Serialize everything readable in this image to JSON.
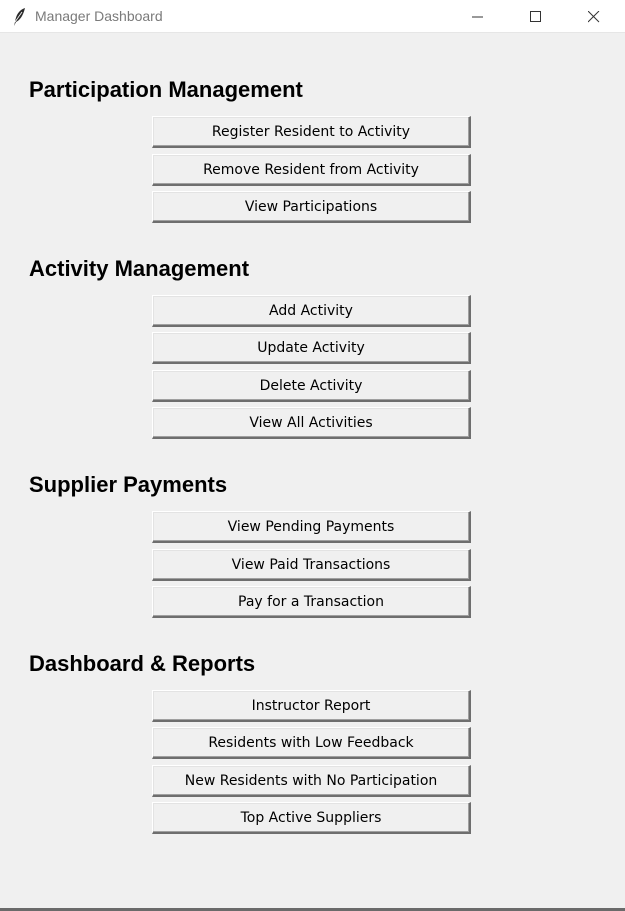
{
  "window": {
    "title": "Manager Dashboard",
    "icon": "feather-icon",
    "controls": [
      "minimize-icon",
      "maximize-icon",
      "close-icon"
    ]
  },
  "sections": [
    {
      "title": "Participation Management",
      "buttons": [
        "Register Resident to Activity",
        "Remove Resident from Activity",
        "View Participations"
      ]
    },
    {
      "title": "Activity Management",
      "buttons": [
        "Add Activity",
        "Update Activity",
        "Delete Activity",
        "View All Activities"
      ]
    },
    {
      "title": "Supplier Payments",
      "buttons": [
        "View Pending Payments",
        "View Paid Transactions",
        "Pay for a Transaction"
      ]
    },
    {
      "title": "Dashboard & Reports",
      "buttons": [
        "Instructor Report",
        "Residents with Low Feedback",
        "New Residents with No Participation",
        "Top Active Suppliers"
      ]
    }
  ]
}
